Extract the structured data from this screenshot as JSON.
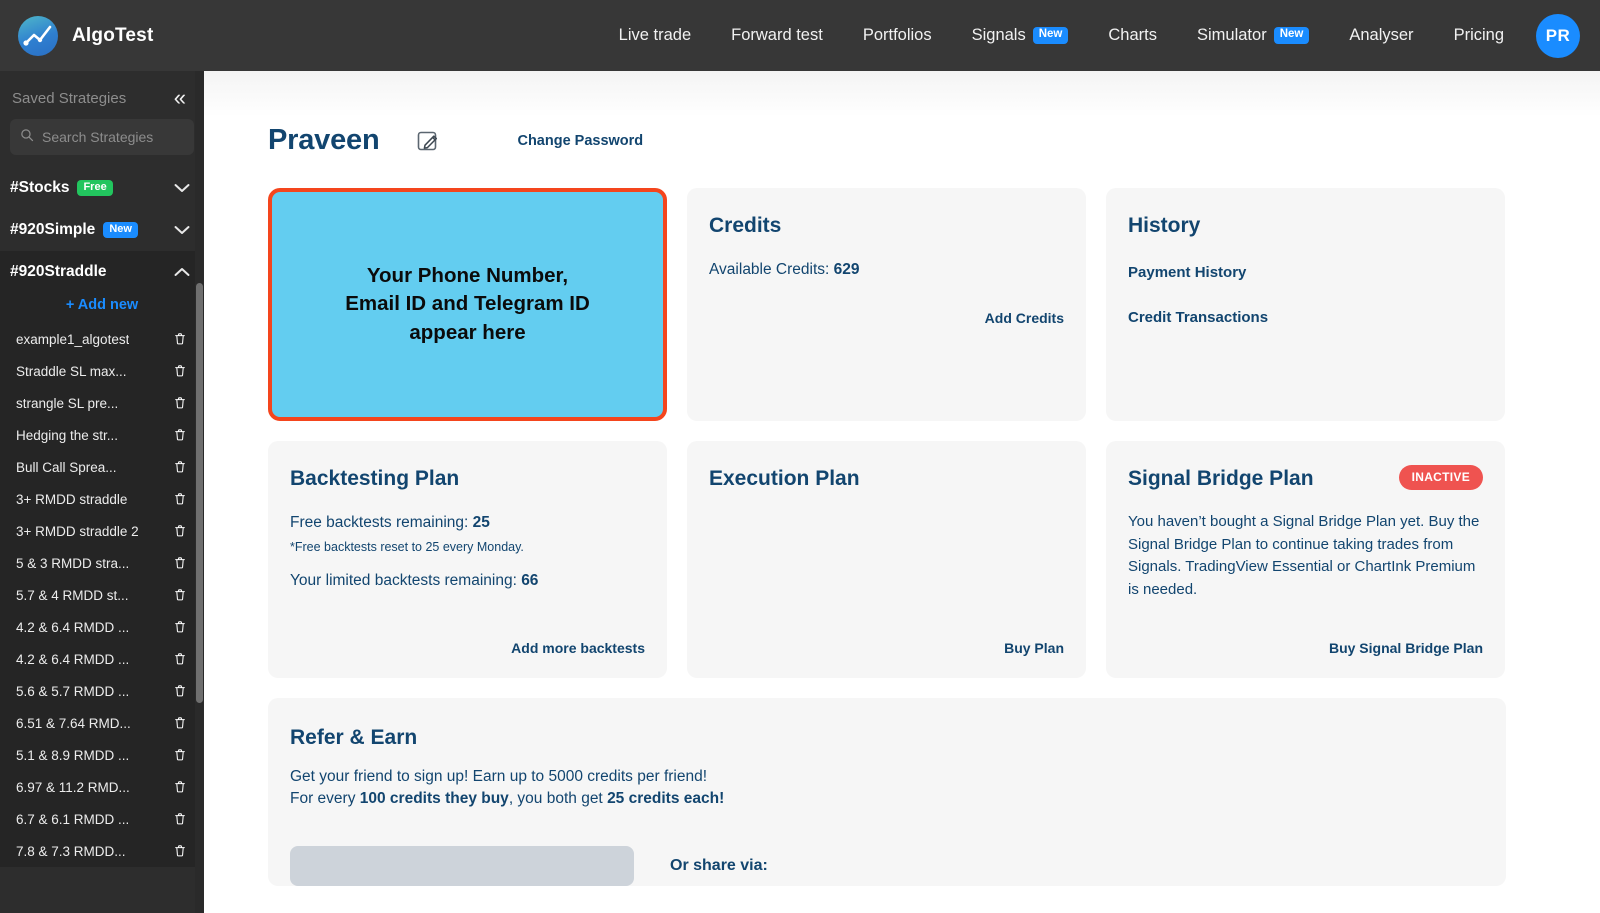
{
  "topnav": {
    "brand": "AlgoTest",
    "links": [
      {
        "label": "Live trade",
        "badge": null
      },
      {
        "label": "Forward test",
        "badge": null
      },
      {
        "label": "Portfolios",
        "badge": null
      },
      {
        "label": "Signals",
        "badge": "New"
      },
      {
        "label": "Charts",
        "badge": null
      },
      {
        "label": "Simulator",
        "badge": "New"
      },
      {
        "label": "Analyser",
        "badge": null
      },
      {
        "label": "Pricing",
        "badge": null
      }
    ],
    "avatar_initials": "PR"
  },
  "sidebar": {
    "title": "Saved Strategies",
    "search_placeholder": "Search Strategies",
    "search_value": "",
    "groups": [
      {
        "label": "#Stocks",
        "badge": "Free",
        "badge_color": "#22c55e",
        "expanded": false
      },
      {
        "label": "#920Simple",
        "badge": "New",
        "badge_color": "#1a8cff",
        "expanded": false
      },
      {
        "label": "#920Straddle",
        "badge": null,
        "badge_color": null,
        "expanded": true
      }
    ],
    "add_new_label": "+ Add new",
    "items": [
      "example1_algotest",
      "Straddle SL max...",
      "strangle SL pre...",
      "Hedging the str...",
      "Bull Call Sprea...",
      "3+ RMDD straddle",
      "3+ RMDD straddle 2",
      "5 & 3 RMDD stra...",
      "5.7 & 4 RMDD st...",
      "4.2 & 6.4 RMDD ...",
      "4.2 & 6.4 RMDD ...",
      "5.6 & 5.7 RMDD ...",
      "6.51 & 7.64 RMD...",
      "5.1 & 8.9 RMDD ...",
      "6.97 & 11.2 RMD...",
      "6.7 & 6.1 RMDD ...",
      "7.8 & 7.3 RMDD..."
    ]
  },
  "page": {
    "title": "Praveen",
    "change_password": "Change Password"
  },
  "cards": {
    "contact": {
      "text_line1": "Your Phone Number,",
      "text_line2": "Email ID and Telegram ID",
      "text_line3": "appear here",
      "bg_color": "#63cdf0",
      "border_color": "#f4451d"
    },
    "credits": {
      "title": "Credits",
      "available_label": "Available Credits:",
      "available_value": "629",
      "link": "Add Credits"
    },
    "history": {
      "title": "History",
      "link1": "Payment History",
      "link2": "Credit Transactions"
    },
    "backtesting": {
      "title": "Backtesting Plan",
      "free_label": "Free backtests remaining:",
      "free_value": "25",
      "note": "*Free backtests reset to 25 every Monday.",
      "limited_label": "Your limited backtests remaining:",
      "limited_value": "66",
      "link": "Add more backtests"
    },
    "execution": {
      "title": "Execution Plan",
      "link": "Buy Plan"
    },
    "signal_bridge": {
      "title": "Signal Bridge Plan",
      "status": "INACTIVE",
      "status_color": "#ef5350",
      "description": "You haven’t bought a Signal Bridge Plan yet. Buy the Signal Bridge Plan to continue taking trades from Signals. TradingView Essential or ChartInk Premium is needed.",
      "link": "Buy Signal Bridge Plan"
    }
  },
  "refer": {
    "title": "Refer & Earn",
    "line1": "Get your friend to sign up! Earn up to 5000 credits per friend!",
    "line2_pre": "For every ",
    "line2_b1": "100 credits they buy",
    "line2_mid": ", you both get ",
    "line2_b2": "25 credits each!",
    "referral_code": "",
    "share_label": "Or share via:"
  },
  "colors": {
    "navbar_bg": "#373737",
    "sidebar_bg": "#2d2d2d",
    "brand_blue": "#12456f",
    "accent_blue": "#1a8cff"
  }
}
